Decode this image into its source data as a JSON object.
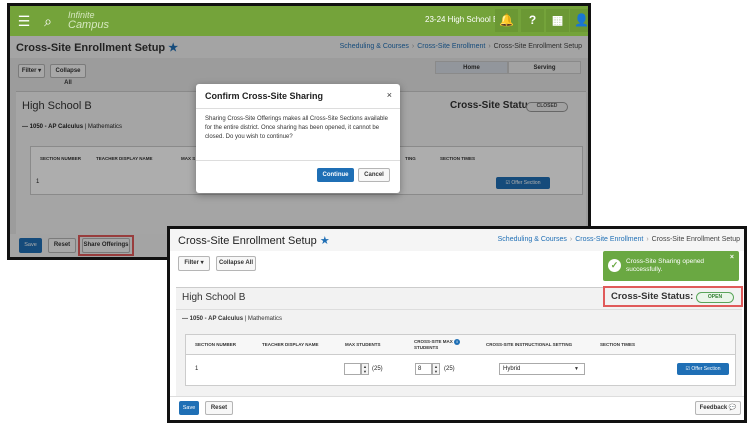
{
  "bg_screen": {
    "topbar": {
      "menu_icon": "hamburger-icon",
      "search_icon": "search-icon",
      "logo_line1": "Infinite",
      "logo_line2": "Campus",
      "school_year": "23-24 High School B",
      "bell_icon": "bell-icon",
      "help": "?",
      "grid_icon": "apps-grid-icon",
      "user_icon": "user-icon"
    },
    "title": "Cross-Site Enrollment Setup",
    "breadcrumb": [
      "Scheduling & Courses",
      "Cross-Site Enrollment",
      "Cross-Site Enrollment Setup"
    ],
    "filter_label": "Filter ▾",
    "collapse_label": "Collapse All",
    "tabs": [
      "Home",
      "Serving"
    ],
    "school": "High School B",
    "status_label": "Cross-Site Status:",
    "status_value": "CLOSED",
    "course_prefix": "— 1050 - AP Calculus",
    "course_dept": "| Mathematics",
    "columns": [
      "SECTION NUMBER",
      "TEACHER DISPLAY NAME",
      "MAX S",
      "TING",
      "SECTION TIMES"
    ],
    "row_section": "1",
    "offer_label": "☑ Offer Section",
    "save": "Save",
    "reset": "Reset",
    "share": "Share Offerings",
    "dialog": {
      "title": "Confirm Cross-Site Sharing",
      "close": "×",
      "body": "Sharing Cross-Site Offerings makes all Cross-Site Sections available for the entire district. Once sharing has been opened, it cannot be closed. Do you wish to continue?",
      "continue": "Continue",
      "cancel": "Cancel"
    }
  },
  "fg_screen": {
    "title": "Cross-Site Enrollment Setup",
    "breadcrumb": [
      "Scheduling & Courses",
      "Cross-Site Enrollment",
      "Cross-Site Enrollment Setup"
    ],
    "filter_label": "Filter ▾",
    "collapse_label": "Collapse All",
    "school": "High School B",
    "status_label": "Cross-Site Status:",
    "status_value": "OPEN",
    "course_prefix": "— 1050 - AP Calculus",
    "course_dept": "| Mathematics",
    "columns": {
      "section_number": "SECTION NUMBER",
      "teacher": "TEACHER DISPLAY NAME",
      "max_students": "MAX STUDENTS",
      "cs_max_1": "CROSS-SITE MAX",
      "cs_max_2": "STUDENTS",
      "instructional": "CROSS-SITE INSTRUCTIONAL SETTING",
      "section_times": "SECTION TIMES"
    },
    "row": {
      "section": "1",
      "max_students_value": "",
      "max_students_cap": "(25)",
      "cs_max_value": "8",
      "cs_max_cap": "(25)",
      "setting": "Hybrid",
      "offer_label": "☑ Offer Section"
    },
    "toast": {
      "message": "Cross-Site Sharing opened successfully.",
      "close": "×"
    },
    "save": "Save",
    "reset": "Reset",
    "feedback": "Feedback 💬"
  },
  "colors": {
    "topbar_green": "#74a33a",
    "primary_blue": "#1f6fb5",
    "highlight_red": "#e05a5a",
    "toast_green": "#6aa842"
  }
}
